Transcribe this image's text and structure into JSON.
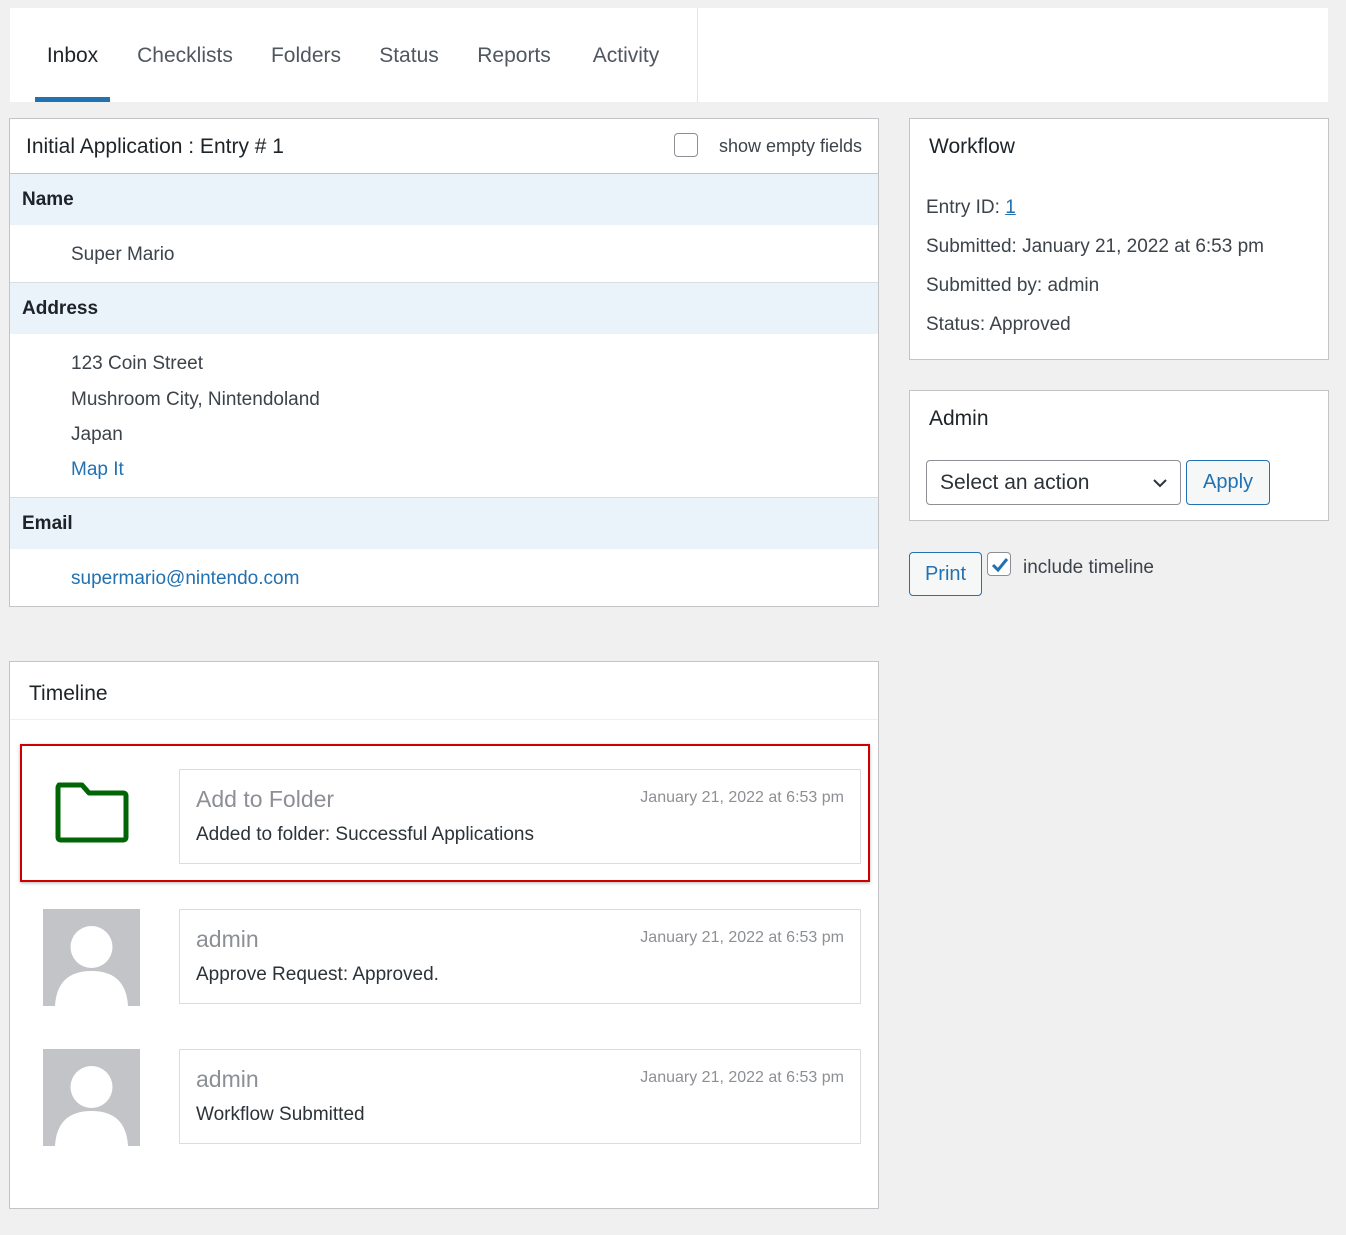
{
  "tabs": [
    {
      "label": "Inbox",
      "active": true
    },
    {
      "label": "Checklists"
    },
    {
      "label": "Folders"
    },
    {
      "label": "Status"
    },
    {
      "label": "Reports"
    },
    {
      "label": "Activity"
    }
  ],
  "entry": {
    "title": "Initial Application : Entry # 1",
    "show_empty_label": "show empty fields",
    "fields": {
      "name": {
        "label": "Name",
        "value": "Super Mario"
      },
      "address": {
        "label": "Address",
        "line1": "123 Coin Street",
        "line2": "Mushroom City, Nintendoland",
        "line3": "Japan",
        "map_link": "Map It"
      },
      "email": {
        "label": "Email",
        "value": "supermario@nintendo.com"
      }
    }
  },
  "workflow": {
    "title": "Workflow",
    "entry_id_label": "Entry ID: ",
    "entry_id": "1",
    "submitted": "Submitted: January 21, 2022 at 6:53 pm",
    "submitted_by": "Submitted by: admin",
    "status": "Status: Approved"
  },
  "admin": {
    "title": "Admin",
    "select_value": "Select an action",
    "apply_label": "Apply"
  },
  "print": {
    "button_label": "Print",
    "include_timeline_label": "include timeline",
    "include_timeline_checked": true
  },
  "timeline": {
    "title": "Timeline",
    "notes": [
      {
        "title": "Add to Folder",
        "date": "January 21, 2022 at 6:53 pm",
        "body": "Added to folder: Successful Applications",
        "icon": "folder-icon"
      },
      {
        "title": "admin",
        "date": "January 21, 2022 at 6:53 pm",
        "body": "Approve Request: Approved.",
        "icon": "avatar"
      },
      {
        "title": "admin",
        "date": "January 21, 2022 at 6:53 pm",
        "body": "Workflow Submitted",
        "icon": "avatar"
      }
    ]
  },
  "colors": {
    "accent": "#2271b1",
    "folder_green": "#006505",
    "highlight_red": "#cc0000",
    "label_bg": "#eaf2fa"
  }
}
